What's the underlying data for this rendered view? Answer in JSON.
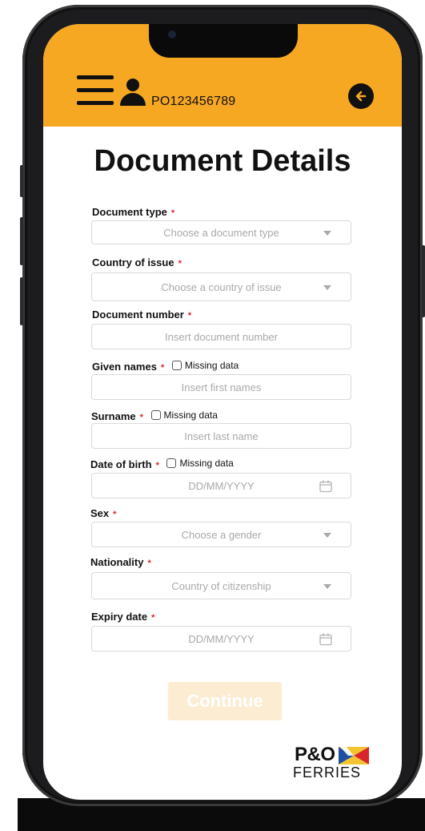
{
  "header": {
    "booking_ref": "PO123456789",
    "background_color": "#f7a823",
    "icons": [
      "menu-icon",
      "user-icon",
      "back-arrow-icon"
    ]
  },
  "page": {
    "title": "Document Details"
  },
  "form": {
    "required_marker": "*",
    "missing_data_label": "Missing data",
    "document_type": {
      "label": "Document type",
      "placeholder": "Choose a document type"
    },
    "country_of_issue": {
      "label": "Country of issue",
      "placeholder": "Choose a country of issue"
    },
    "document_number": {
      "label": "Document number",
      "placeholder": "Insert document number"
    },
    "given_names": {
      "label": "Given names",
      "placeholder": "Insert first names"
    },
    "surname": {
      "label": "Surname",
      "placeholder": "Insert last name"
    },
    "date_of_birth": {
      "label": "Date of birth",
      "placeholder": "DD/MM/YYYY"
    },
    "sex": {
      "label": "Sex",
      "placeholder": "Choose a gender"
    },
    "nationality": {
      "label": "Nationality",
      "placeholder": "Country of citizenship"
    },
    "expiry_date": {
      "label": "Expiry date",
      "placeholder": "DD/MM/YYYY"
    }
  },
  "actions": {
    "continue_label": "Continue"
  },
  "brand": {
    "line1": "P&O",
    "line2": "FERRIES"
  }
}
